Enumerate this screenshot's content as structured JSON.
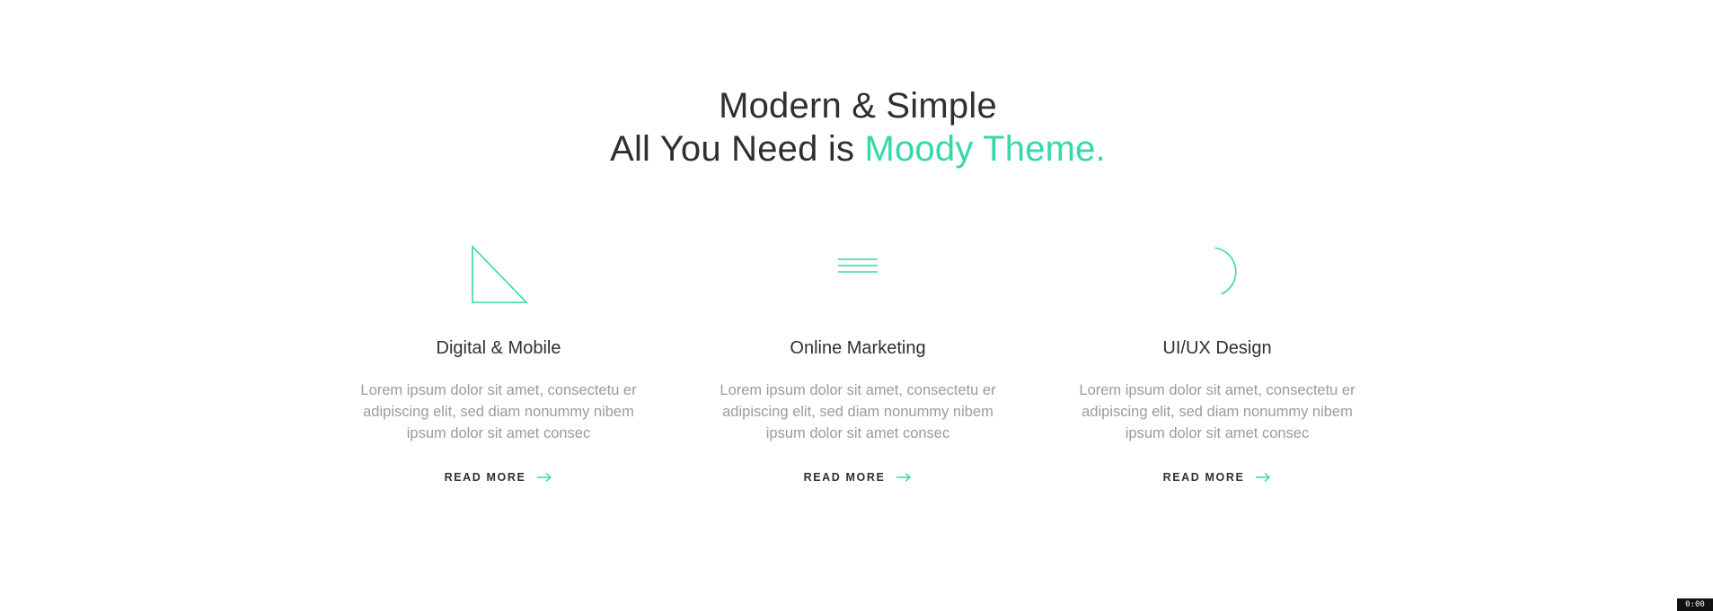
{
  "heading": {
    "line1": "Modern & Simple",
    "line2_prefix": "All You Need is ",
    "line2_accent": "Moody Theme."
  },
  "colors": {
    "accent": "#34d9a7",
    "text": "#2f2f2f",
    "muted": "#9b9b9b"
  },
  "features": [
    {
      "icon": "triangle-icon",
      "title": "Digital & Mobile",
      "text": "Lorem ipsum dolor sit amet, consectetu er adipiscing elit, sed diam nonummy nibem ipsum dolor sit amet consec",
      "link": "READ MORE"
    },
    {
      "icon": "lines-icon",
      "title": "Online Marketing",
      "text": "Lorem ipsum dolor sit amet, consectetu er adipiscing elit, sed diam nonummy nibem ipsum dolor sit amet consec",
      "link": "READ MORE"
    },
    {
      "icon": "half-circle-icon",
      "title": "UI/UX Design",
      "text": "Lorem ipsum dolor sit amet, consectetu er adipiscing elit, sed diam nonummy nibem ipsum dolor sit amet consec",
      "link": "READ MORE"
    }
  ],
  "timer": "0:00"
}
